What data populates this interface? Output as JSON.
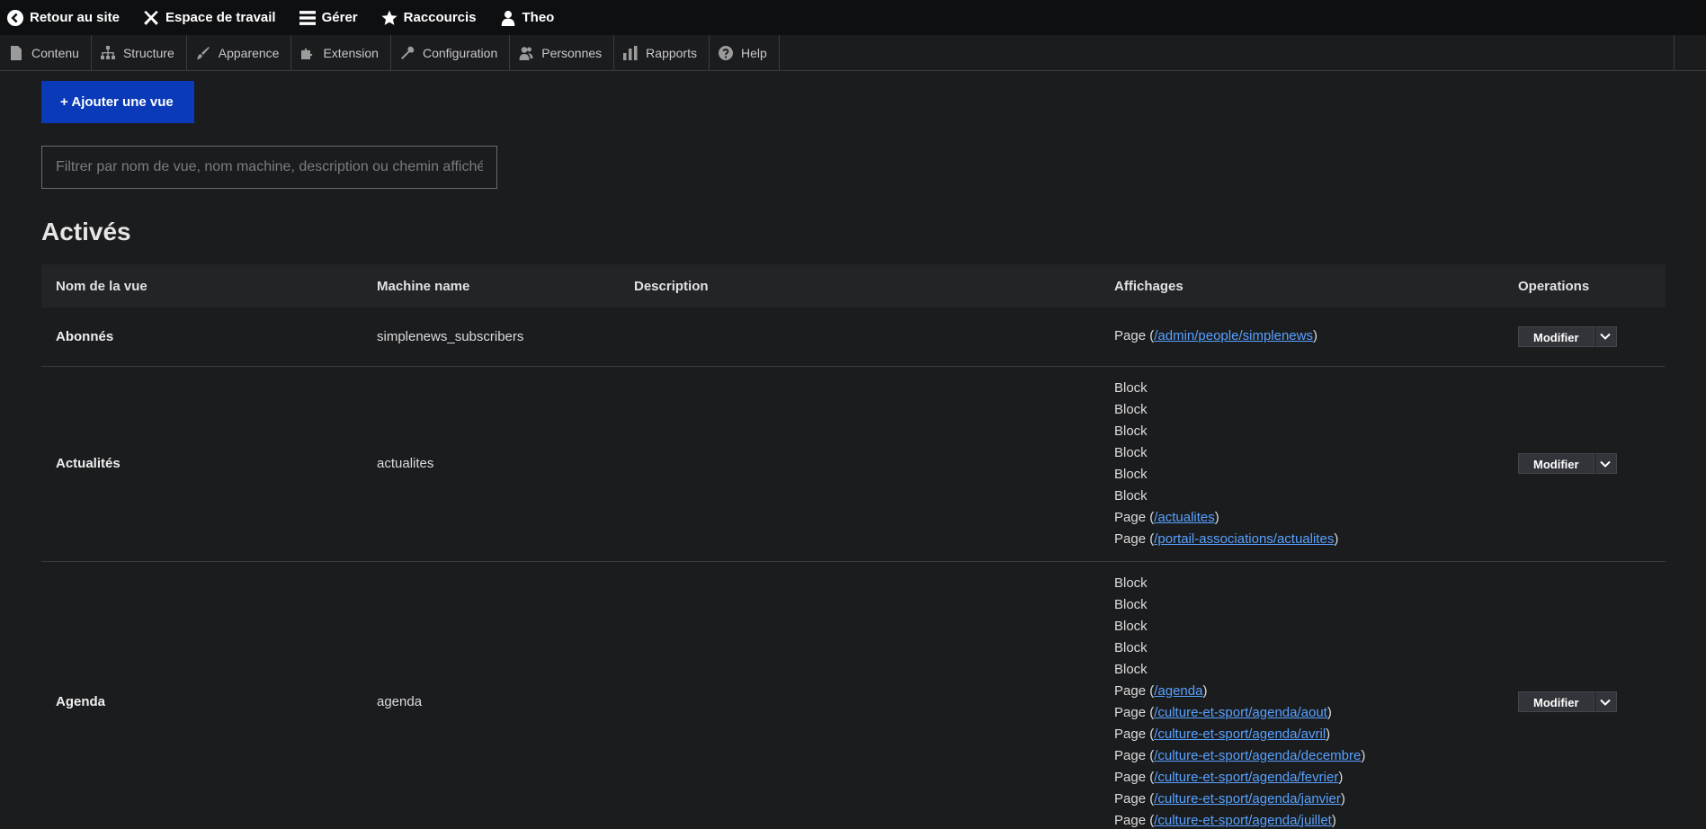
{
  "toolbar": {
    "back": "Retour au site",
    "workspace": "Espace de travail",
    "manage": "Gérer",
    "shortcuts": "Raccourcis",
    "user": "Theo"
  },
  "tray": {
    "items": [
      "Contenu",
      "Structure",
      "Apparence",
      "Extension",
      "Configuration",
      "Personnes",
      "Rapports",
      "Help"
    ]
  },
  "main": {
    "add_button": "+ Ajouter une vue",
    "filter_placeholder": "Filtrer par nom de vue, nom machine, description ou chemin affiché",
    "section_title": "Activés"
  },
  "table": {
    "headers": [
      "Nom de la vue",
      "Machine name",
      "Description",
      "Affichages",
      "Operations"
    ],
    "rows": [
      {
        "name": "Abonnés",
        "machine": "simplenews_subscribers",
        "description": "",
        "displays": [
          {
            "type": "Page",
            "path": "/admin/people/simplenews"
          }
        ],
        "op": "Modifier"
      },
      {
        "name": "Actualités",
        "machine": "actualites",
        "description": "",
        "displays": [
          {
            "type": "Block"
          },
          {
            "type": "Block"
          },
          {
            "type": "Block"
          },
          {
            "type": "Block"
          },
          {
            "type": "Block"
          },
          {
            "type": "Block"
          },
          {
            "type": "Page",
            "path": "/actualites"
          },
          {
            "type": "Page",
            "path": "/portail-associations/actualites"
          }
        ],
        "op": "Modifier"
      },
      {
        "name": "Agenda",
        "machine": "agenda",
        "description": "",
        "displays": [
          {
            "type": "Block"
          },
          {
            "type": "Block"
          },
          {
            "type": "Block"
          },
          {
            "type": "Block"
          },
          {
            "type": "Block"
          },
          {
            "type": "Page",
            "path": "/agenda"
          },
          {
            "type": "Page",
            "path": "/culture-et-sport/agenda/aout"
          },
          {
            "type": "Page",
            "path": "/culture-et-sport/agenda/avril"
          },
          {
            "type": "Page",
            "path": "/culture-et-sport/agenda/decembre"
          },
          {
            "type": "Page",
            "path": "/culture-et-sport/agenda/fevrier"
          },
          {
            "type": "Page",
            "path": "/culture-et-sport/agenda/janvier"
          },
          {
            "type": "Page",
            "path": "/culture-et-sport/agenda/juillet"
          }
        ],
        "op": "Modifier"
      }
    ]
  }
}
